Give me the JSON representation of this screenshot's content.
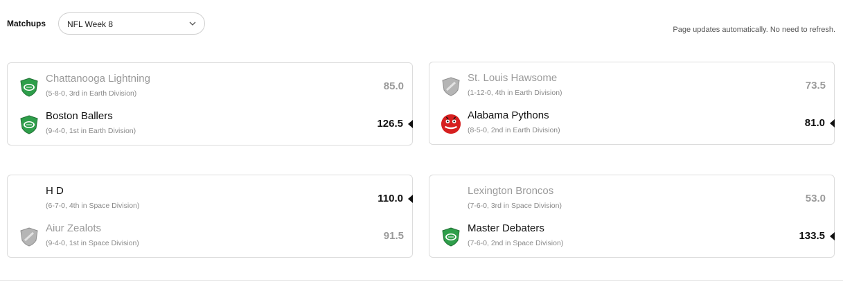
{
  "header": {
    "matchups_label": "Matchups",
    "week_select_value": "NFL Week 8",
    "auto_note": "Page updates automatically. No need to refresh."
  },
  "matchups": [
    {
      "team1": {
        "name": "Chattanooga Lightning",
        "record": "(5-8-0, 3rd in Earth Division)",
        "score": "85.0",
        "logo": "football-shield-green-icon"
      },
      "team2": {
        "name": "Boston Ballers",
        "record": "(9-4-0, 1st in Earth Division)",
        "score": "126.5",
        "logo": "football-shield-green-icon"
      }
    },
    {
      "team1": {
        "name": "St. Louis Hawsome",
        "record": "(1-12-0, 4th in Earth Division)",
        "score": "73.5",
        "logo": "gray-shield-icon"
      },
      "team2": {
        "name": "Alabama Pythons",
        "record": "(8-5-0, 2nd in Earth Division)",
        "score": "81.0",
        "logo": "pythons-red-logo-icon"
      }
    },
    {
      "team1": {
        "name": "H D",
        "record": "(6-7-0, 4th in Space Division)",
        "score": "110.0",
        "logo": "none"
      },
      "team2": {
        "name": "Aiur Zealots",
        "record": "(9-4-0, 1st in Space Division)",
        "score": "91.5",
        "logo": "gray-shield-icon"
      }
    },
    {
      "team1": {
        "name": "Lexington Broncos",
        "record": "(7-6-0, 3rd in Space Division)",
        "score": "53.0",
        "logo": "none"
      },
      "team2": {
        "name": "Master Debaters",
        "record": "(7-6-0, 2nd in Space Division)",
        "score": "133.5",
        "logo": "football-shield-green-icon"
      }
    }
  ],
  "colors": {
    "shield_green": "#2e9e4a",
    "shield_gray": "#a6a6a6",
    "pythons_red": "#d62020",
    "loser_text": "#9a9a9a"
  }
}
